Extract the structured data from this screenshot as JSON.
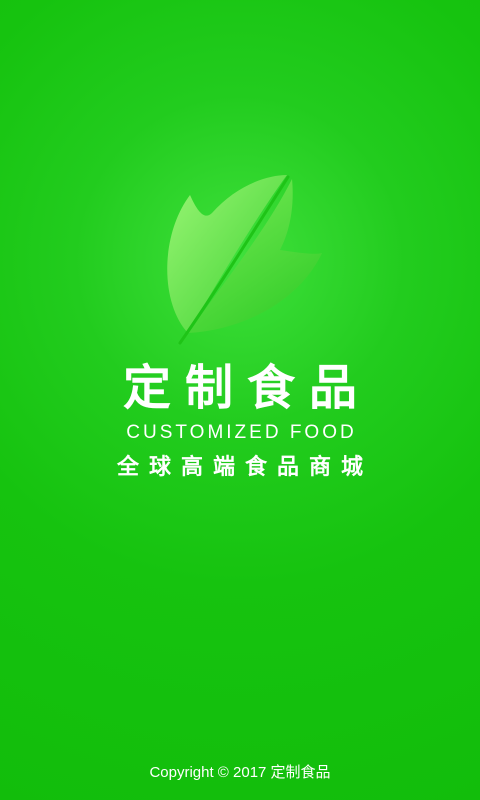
{
  "splash": {
    "title": "定制食品",
    "subtitle_en": "CUSTOMIZED FOOD",
    "slogan": "全球高端食品商城",
    "copyright": "Copyright © 2017 定制食品",
    "logo_icon": "leaf-icon"
  },
  "colors": {
    "background": "#12bd0b",
    "background_glow": "#3fe03c",
    "leaf_light": "#8cf06a",
    "leaf_dark": "#2fce25",
    "text": "#ffffff"
  }
}
